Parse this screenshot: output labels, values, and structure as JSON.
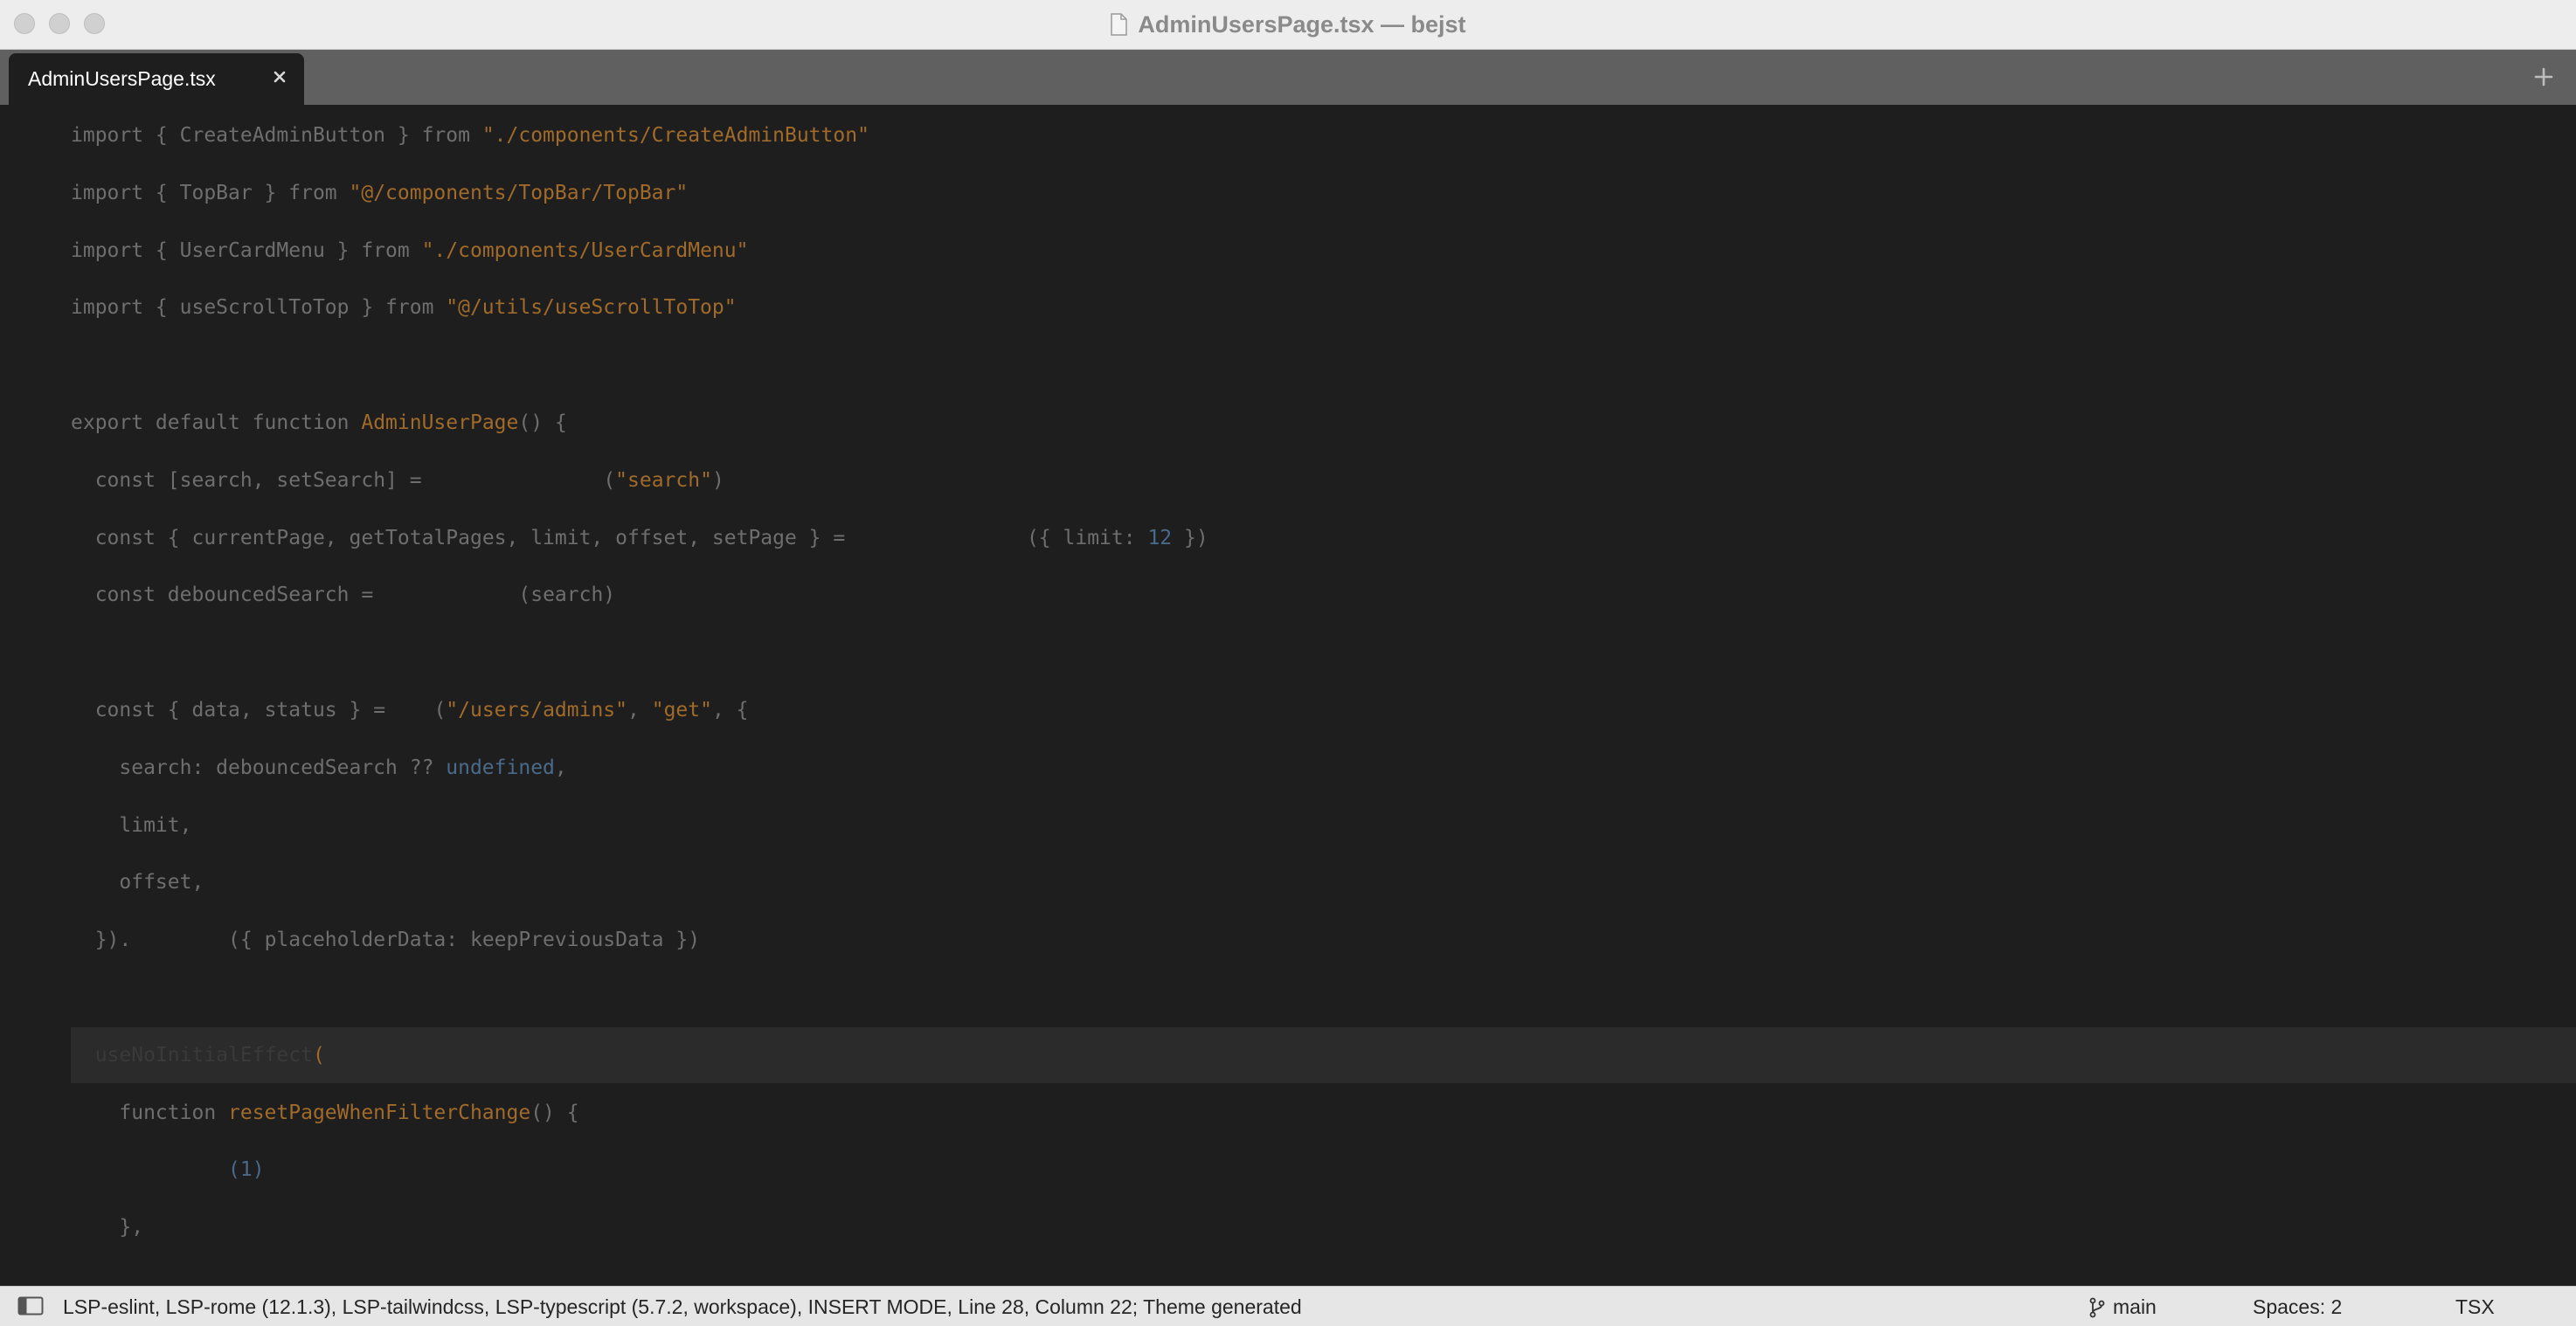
{
  "window": {
    "title": "AdminUsersPage.tsx — bejst"
  },
  "tabs": [
    {
      "label": "AdminUsersPage.tsx",
      "active": true
    }
  ],
  "editor": {
    "lines": [
      {
        "indent": 0,
        "tokens": [
          {
            "t": "import { CreateAdminButton } from ",
            "c": "kw"
          },
          {
            "t": "\"./components/CreateAdminButton\"",
            "c": "str"
          }
        ]
      },
      {
        "indent": 0,
        "tokens": [
          {
            "t": "import { TopBar } from ",
            "c": "kw"
          },
          {
            "t": "\"@/components/TopBar/TopBar\"",
            "c": "str"
          }
        ]
      },
      {
        "indent": 0,
        "tokens": [
          {
            "t": "import { UserCardMenu } from ",
            "c": "kw"
          },
          {
            "t": "\"./components/UserCardMenu\"",
            "c": "str"
          }
        ]
      },
      {
        "indent": 0,
        "tokens": [
          {
            "t": "import { useScrollToTop } from ",
            "c": "kw"
          },
          {
            "t": "\"@/utils/useScrollToTop\"",
            "c": "str"
          }
        ]
      },
      {
        "indent": 0,
        "tokens": []
      },
      {
        "indent": 0,
        "tokens": [
          {
            "t": "export default function ",
            "c": "kw"
          },
          {
            "t": "AdminUserPage",
            "c": "fn"
          },
          {
            "t": "() {",
            "c": "kw"
          }
        ]
      },
      {
        "indent": 1,
        "tokens": [
          {
            "t": "const [search, setSearch] = ",
            "c": "kw"
          },
          {
            "t": "              ",
            "c": "kw"
          },
          {
            "t": "(",
            "c": "kw"
          },
          {
            "t": "\"search\"",
            "c": "str"
          },
          {
            "t": ")",
            "c": "kw"
          }
        ]
      },
      {
        "indent": 1,
        "tokens": [
          {
            "t": "const { currentPage, getTotalPages, limit, offset, setPage } = ",
            "c": "kw"
          },
          {
            "t": "              ",
            "c": "kw"
          },
          {
            "t": "({ limit: ",
            "c": "kw"
          },
          {
            "t": "12",
            "c": "num"
          },
          {
            "t": " })",
            "c": "kw"
          }
        ]
      },
      {
        "indent": 1,
        "tokens": [
          {
            "t": "const debouncedSearch = ",
            "c": "kw"
          },
          {
            "t": "           ",
            "c": "kw"
          },
          {
            "t": "(search)",
            "c": "kw"
          }
        ]
      },
      {
        "indent": 0,
        "tokens": []
      },
      {
        "indent": 1,
        "tokens": [
          {
            "t": "const { data, status } = ",
            "c": "kw"
          },
          {
            "t": "   ",
            "c": "kw"
          },
          {
            "t": "(",
            "c": "kw"
          },
          {
            "t": "\"/users/admins\"",
            "c": "str"
          },
          {
            "t": ", ",
            "c": "kw"
          },
          {
            "t": "\"get\"",
            "c": "str"
          },
          {
            "t": ", {",
            "c": "kw"
          }
        ]
      },
      {
        "indent": 2,
        "tokens": [
          {
            "t": "search: debouncedSearch ?? ",
            "c": "kw"
          },
          {
            "t": "undefined",
            "c": "num"
          },
          {
            "t": ",",
            "c": "kw"
          }
        ]
      },
      {
        "indent": 2,
        "tokens": [
          {
            "t": "limit,",
            "c": "kw"
          }
        ]
      },
      {
        "indent": 2,
        "tokens": [
          {
            "t": "offset,",
            "c": "kw"
          }
        ]
      },
      {
        "indent": 1,
        "tokens": [
          {
            "t": "}).",
            "c": "kw"
          },
          {
            "t": "        ",
            "c": "kw"
          },
          {
            "t": "({ placeholderData: keepPreviousData })",
            "c": "kw"
          }
        ]
      },
      {
        "indent": 0,
        "tokens": []
      },
      {
        "indent": 1,
        "highlight": true,
        "tokens": [
          {
            "t": "useNoInitialEffect",
            "c": "dim"
          },
          {
            "t": "(",
            "c": "fn"
          }
        ]
      },
      {
        "indent": 2,
        "tokens": [
          {
            "t": "function ",
            "c": "kw"
          },
          {
            "t": "resetPageWhenFilterChange",
            "c": "fn"
          },
          {
            "t": "() {",
            "c": "kw"
          }
        ]
      },
      {
        "indent": 3,
        "tokens": [
          {
            "t": "       ",
            "c": "kw"
          },
          {
            "t": "(1)",
            "c": "num"
          }
        ]
      },
      {
        "indent": 2,
        "tokens": [
          {
            "t": "},",
            "c": "kw"
          }
        ]
      }
    ]
  },
  "statusbar": {
    "text": "LSP-eslint, LSP-rome (12.1.3), LSP-tailwindcss, LSP-typescript (5.7.2, workspace), INSERT MODE, Line 28, Column 22; Theme generated",
    "branch": "main",
    "spaces": "Spaces: 2",
    "syntax": "TSX"
  }
}
